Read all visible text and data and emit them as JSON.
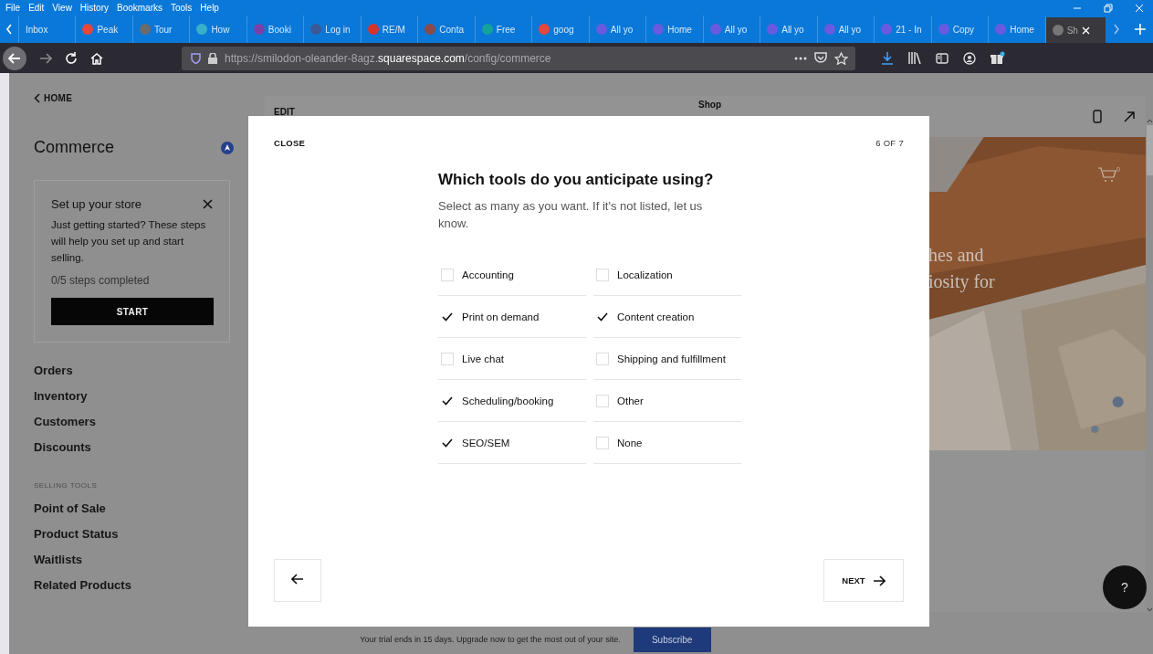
{
  "menu_bar": [
    "File",
    "Edit",
    "View",
    "History",
    "Bookmarks",
    "Tools",
    "Help"
  ],
  "tabs": [
    {
      "label": "Inbox",
      "selected": false
    },
    {
      "label": "Peak",
      "selected": false,
      "color": "#e8453c"
    },
    {
      "label": "Tour",
      "selected": false,
      "color": "#6b6b6b"
    },
    {
      "label": "How",
      "selected": false,
      "color": "#3ab0c8"
    },
    {
      "label": "Booki",
      "selected": false,
      "color": "#7b3fa8"
    },
    {
      "label": "Log in",
      "selected": false,
      "color": "#3b5998"
    },
    {
      "label": "RE/M",
      "selected": false,
      "color": "#d8322e"
    },
    {
      "label": "Conta",
      "selected": false,
      "color": "#8a4a4a"
    },
    {
      "label": "Free",
      "selected": false,
      "color": "#14a39a"
    },
    {
      "label": "goog",
      "selected": false,
      "color": "#e8453c"
    },
    {
      "label": "All yo",
      "selected": false,
      "color": "#6a5ae0"
    },
    {
      "label": "Home",
      "selected": false,
      "color": "#6a5ae0"
    },
    {
      "label": "All yo",
      "selected": false,
      "color": "#6a5ae0"
    },
    {
      "label": "All yo",
      "selected": false,
      "color": "#6a5ae0"
    },
    {
      "label": "All yo",
      "selected": false,
      "color": "#6a5ae0"
    },
    {
      "label": "21 - In",
      "selected": false,
      "color": "#6a5ae0"
    },
    {
      "label": "Copy",
      "selected": false,
      "color": "#6a5ae0"
    },
    {
      "label": "Home",
      "selected": false,
      "color": "#6a5ae0"
    },
    {
      "label": "Sh",
      "selected": true,
      "color": "#777777"
    }
  ],
  "address_bar": {
    "prefix": "https://smilodon-oleander-8agz.",
    "domain": "squarespace.com",
    "path": "/config/commerce"
  },
  "sidebar": {
    "back": "HOME",
    "title": "Commerce",
    "setup_card": {
      "title": "Set up your store",
      "text": "Just getting started? These steps will help you set up and start selling.",
      "progress": "0/5 steps completed",
      "button": "START"
    },
    "items": [
      "Orders",
      "Inventory",
      "Customers",
      "Discounts"
    ],
    "section": "SELLING TOOLS",
    "tools": [
      "Point of Sale",
      "Product Status",
      "Waitlists",
      "Related Products"
    ]
  },
  "preview": {
    "edit": "EDIT",
    "page_title": "Shop",
    "cart_count": "0",
    "hero_lines": [
      "hes and",
      "iosity for"
    ]
  },
  "modal": {
    "close": "CLOSE",
    "step": "6 OF 7",
    "title": "Which tools do you anticipate using?",
    "subtitle": "Select as many as you want. If it's not listed, let us know.",
    "columns": [
      {
        "options": [
          {
            "label": "Accounting",
            "checked": false
          },
          {
            "label": "Print on demand",
            "checked": true
          },
          {
            "label": "Live chat",
            "checked": false
          },
          {
            "label": "Scheduling/booking",
            "checked": true
          },
          {
            "label": "SEO/SEM",
            "checked": true
          }
        ]
      },
      {
        "options": [
          {
            "label": "Localization",
            "checked": false
          },
          {
            "label": "Content creation",
            "checked": true
          },
          {
            "label": "Shipping and fulfillment",
            "checked": false
          },
          {
            "label": "Other",
            "checked": false
          },
          {
            "label": "None",
            "checked": false
          }
        ]
      }
    ],
    "next": "NEXT"
  },
  "trial_banner": {
    "text": "Your trial ends in 15 days. Upgrade now to get the most out of your site.",
    "button": "Subscribe"
  },
  "help": "?"
}
